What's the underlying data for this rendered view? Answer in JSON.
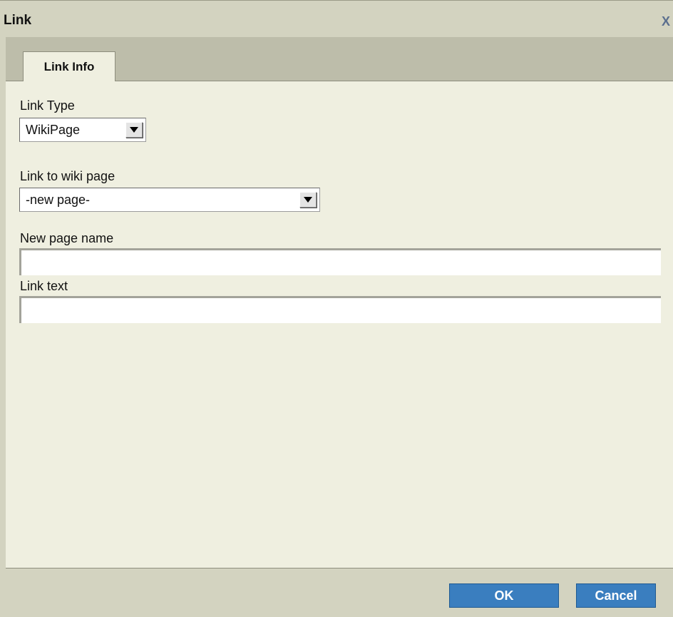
{
  "dialog": {
    "title": "Link",
    "close_label": "X"
  },
  "tabs": [
    {
      "label": "Link Info",
      "active": true
    }
  ],
  "form": {
    "link_type": {
      "label": "Link Type",
      "value": "WikiPage"
    },
    "wiki_page": {
      "label": "Link to wiki page",
      "value": "-new page-"
    },
    "new_page_name": {
      "label": "New page name",
      "value": ""
    },
    "link_text": {
      "label": "Link text",
      "value": ""
    }
  },
  "footer": {
    "ok_label": "OK",
    "cancel_label": "Cancel"
  },
  "colors": {
    "titlebar": "#d3d3c0",
    "tabbar": "#bdbdaa",
    "content": "#efefe0",
    "button": "#3a7ebf",
    "close_icon": "#5b6f8e"
  },
  "icons": {
    "close": "close-icon",
    "dropdown": "dropdown-arrow-icon"
  }
}
